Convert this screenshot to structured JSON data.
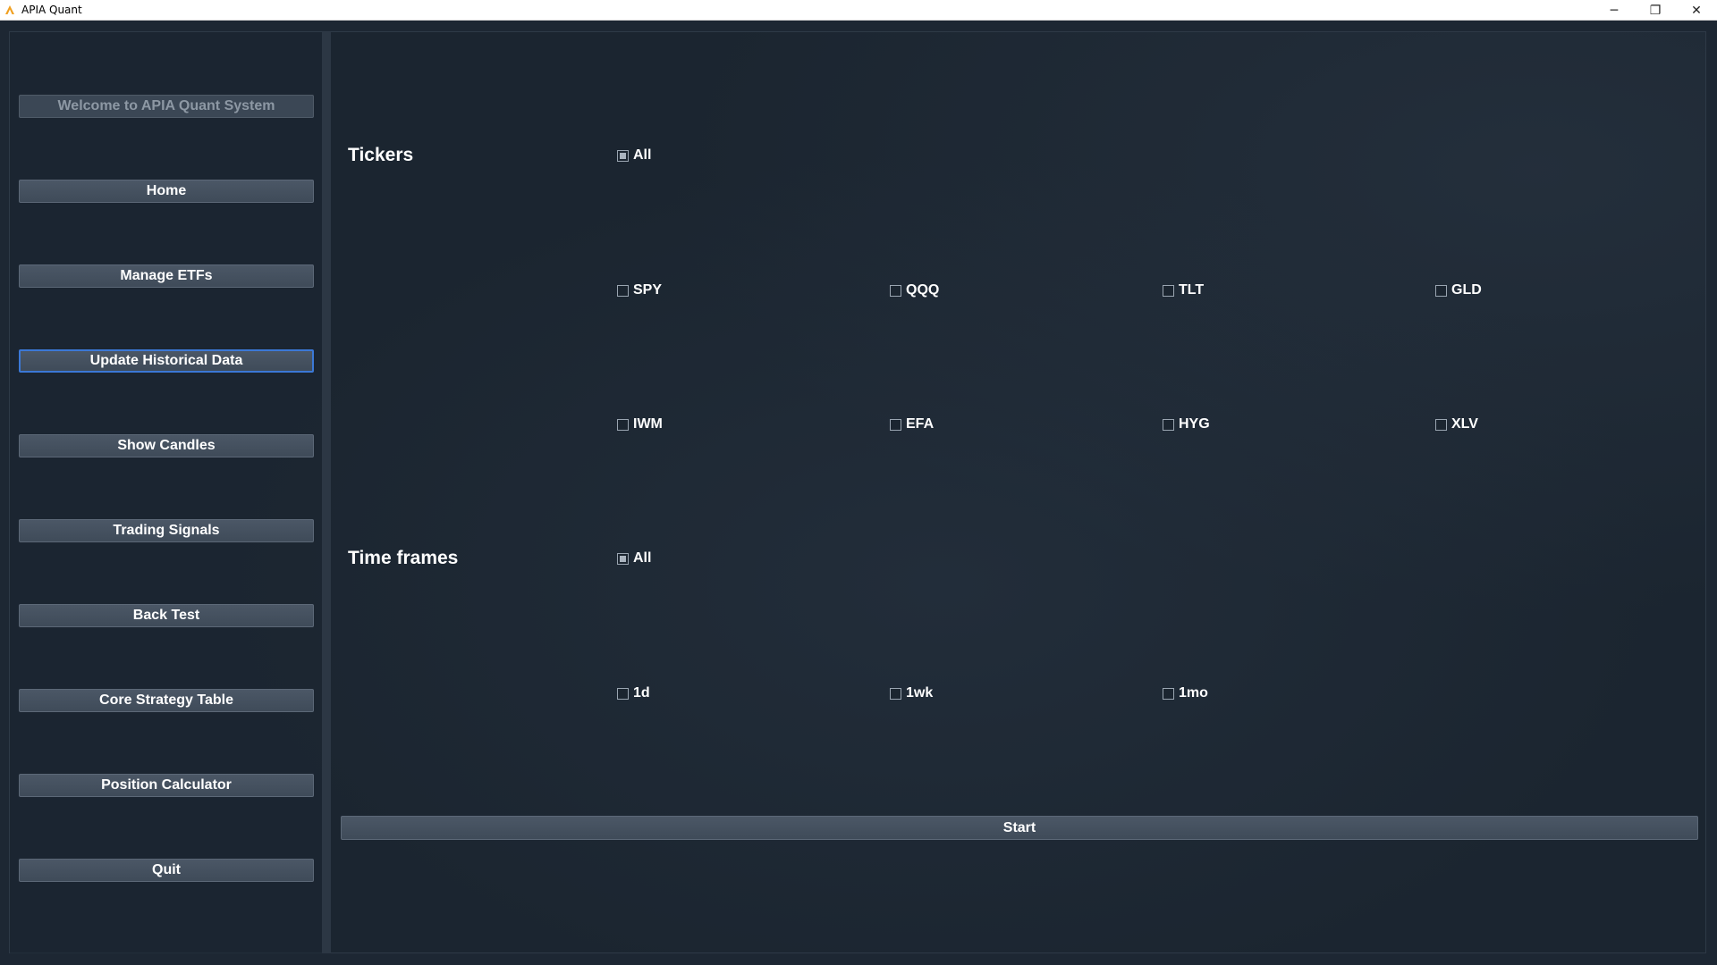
{
  "window": {
    "title": "APIA Quant",
    "controls": {
      "minimize": "─",
      "restore": "❐",
      "close": "✕"
    }
  },
  "sidebar": {
    "welcome": "Welcome to APIA Quant System",
    "items": [
      {
        "label": "Home"
      },
      {
        "label": "Manage ETFs"
      },
      {
        "label": "Update Historical Data"
      },
      {
        "label": "Show Candles"
      },
      {
        "label": "Trading Signals"
      },
      {
        "label": "Back Test"
      },
      {
        "label": "Core Strategy Table"
      },
      {
        "label": "Position Calculator"
      },
      {
        "label": "Quit"
      }
    ]
  },
  "tickers": {
    "title": "Tickers",
    "all_label": "All",
    "all_checked": true,
    "items": [
      "SPY",
      "QQQ",
      "TLT",
      "GLD",
      "IWM",
      "EFA",
      "HYG",
      "XLV"
    ]
  },
  "timeframes": {
    "title": "Time frames",
    "all_label": "All",
    "all_checked": true,
    "items": [
      "1d",
      "1wk",
      "1mo"
    ]
  },
  "start_label": "Start",
  "colors": {
    "background": "#1b2530",
    "button": "#4b5766",
    "focus_border": "#3b78d6",
    "text": "#ffffff"
  }
}
